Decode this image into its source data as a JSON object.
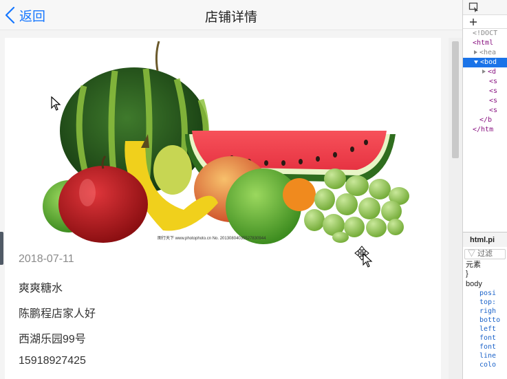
{
  "navbar": {
    "back_label": "返回",
    "title": "店铺详情"
  },
  "hero": {
    "image_caption": "图行天下  www.photophoto.cn   No. 20130804035527830944"
  },
  "shop": {
    "date": "2018-07-11",
    "name": "爽爽糖水",
    "owner": "陈鹏程店家人好",
    "address": "西湖乐园99号",
    "phone": "15918927425"
  },
  "devtools": {
    "tree": [
      "<!DOCT",
      "<html",
      "<hea",
      "<bod",
      "<d",
      "<s",
      "<s",
      "<s",
      "<s",
      "</b",
      "</htm"
    ],
    "file_tab": "html.pi",
    "filter_placeholder": "过滤",
    "styles_header": "元素",
    "brace": "}",
    "selector": "body",
    "props": [
      "posi",
      "top:",
      "righ",
      "botto",
      "left",
      "font",
      "font",
      "line",
      "colo"
    ]
  },
  "colors": {
    "accent": "#1677ff",
    "selected": "#1a73e8"
  }
}
